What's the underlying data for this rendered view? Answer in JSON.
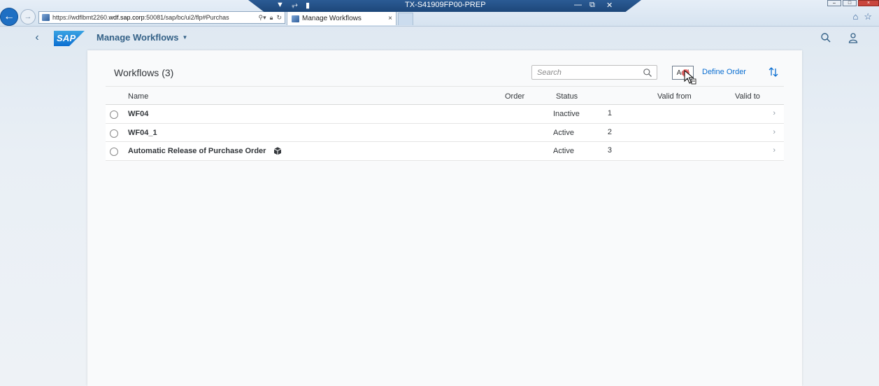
{
  "browser": {
    "remote_session_title": "TX-S41909FP00-PREP",
    "url_prefix": "https://wdflbmt2260.",
    "url_domain": "wdf.sap.corp",
    "url_suffix": ":50081/sap/bc/ui2/flp#Purchas",
    "tab_title": "Manage Workflows",
    "tab_close": "×"
  },
  "shell": {
    "app_title": "Manage Workflows"
  },
  "toolbar": {
    "title": "Workflows (3)",
    "search_placeholder": "Search",
    "add_label": "Add",
    "define_order_label": "Define Order"
  },
  "table": {
    "columns": {
      "name": "Name",
      "order": "Order",
      "status": "Status",
      "valid_from": "Valid from",
      "valid_to": "Valid to"
    },
    "rows": [
      {
        "name": "WF04",
        "order": "1",
        "status": "Inactive"
      },
      {
        "name": "WF04_1",
        "order": "2",
        "status": "Active"
      },
      {
        "name": "Automatic Release of Purchase Order",
        "order": "3",
        "status": "Active",
        "icon": "package-icon"
      }
    ]
  },
  "colors": {
    "accent": "#0a6ed1",
    "shell_text": "#346187",
    "browser_back": "#1e6fc3"
  }
}
